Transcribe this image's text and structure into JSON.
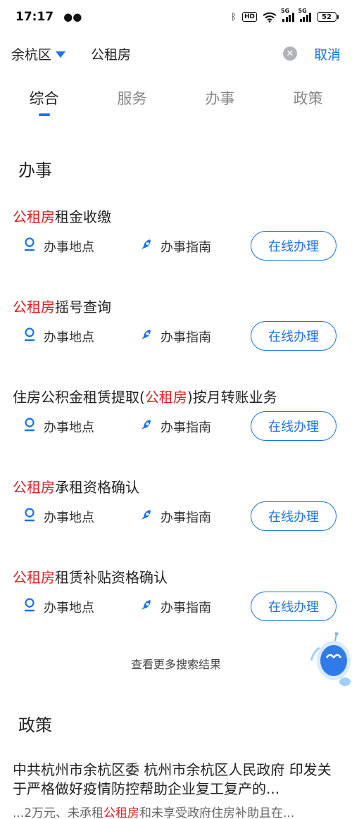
{
  "status_bar": {
    "time": "17:17",
    "hd": "HD",
    "network": "5G",
    "battery": "52"
  },
  "search": {
    "district": "余杭区",
    "query": "公租房",
    "cancel": "取消"
  },
  "tabs": [
    {
      "label": "综合",
      "active": true
    },
    {
      "label": "服务",
      "active": false
    },
    {
      "label": "办事",
      "active": false
    },
    {
      "label": "政策",
      "active": false
    }
  ],
  "affairs": {
    "section_title": "办事",
    "location_label": "办事地点",
    "guide_label": "办事指南",
    "online_label": "在线办理",
    "items": [
      {
        "pre": "",
        "hl": "公租房",
        "post": "租金收缴"
      },
      {
        "pre": "",
        "hl": "公租房",
        "post": "摇号查询"
      },
      {
        "pre": "住房公积金租赁提取(",
        "hl": "公租房",
        "post": ")按月转账业务"
      },
      {
        "pre": "",
        "hl": "公租房",
        "post": "承租资格确认"
      },
      {
        "pre": "",
        "hl": "公租房",
        "post": "租赁补贴资格确认"
      }
    ],
    "more": "查看更多搜索结果"
  },
  "policy": {
    "section_title": "政策",
    "title": "中共杭州市余杭区委 杭州市余杭区人民政府 印发关于严格做好疫情防控帮助企业复工复产的...",
    "snippet_pre": "...2万元、未承租",
    "snippet_hl": "公租房",
    "snippet_post": "和未享受政府住房补助且在..."
  },
  "colors": {
    "accent": "#1a73e8",
    "highlight": "#e02020"
  }
}
